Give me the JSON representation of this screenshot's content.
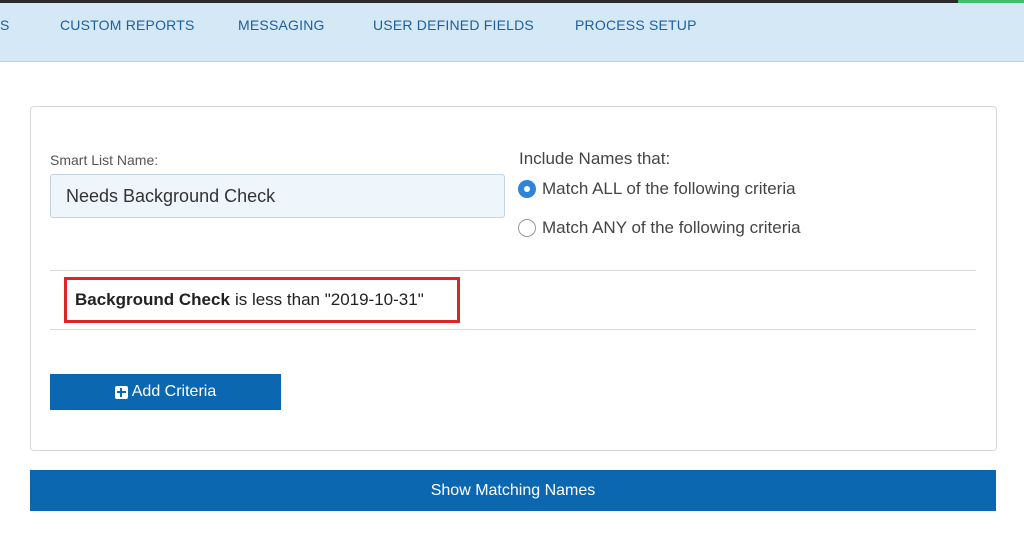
{
  "nav": {
    "items": [
      {
        "label": "S"
      },
      {
        "label": "CUSTOM REPORTS"
      },
      {
        "label": "MESSAGING"
      },
      {
        "label": "USER DEFINED FIELDS"
      },
      {
        "label": "PROCESS SETUP"
      }
    ]
  },
  "form": {
    "name_label": "Smart List Name:",
    "name_value": "Needs Background Check",
    "include_label": "Include Names that:",
    "options": [
      {
        "label": "Match ALL of the following criteria",
        "selected": true
      },
      {
        "label": "Match ANY of the following criteria",
        "selected": false
      }
    ]
  },
  "criteria": [
    {
      "field": "Background Check",
      "condition": "is less than \"2019-10-31\""
    }
  ],
  "buttons": {
    "add_criteria": "Add Criteria",
    "show_matching": "Show Matching Names"
  },
  "colors": {
    "nav_bg": "#d4e8f6",
    "nav_text": "#1d5fa0",
    "primary": "#0c67b1",
    "highlight": "#e02424",
    "radio_checked": "#2e84d6"
  }
}
